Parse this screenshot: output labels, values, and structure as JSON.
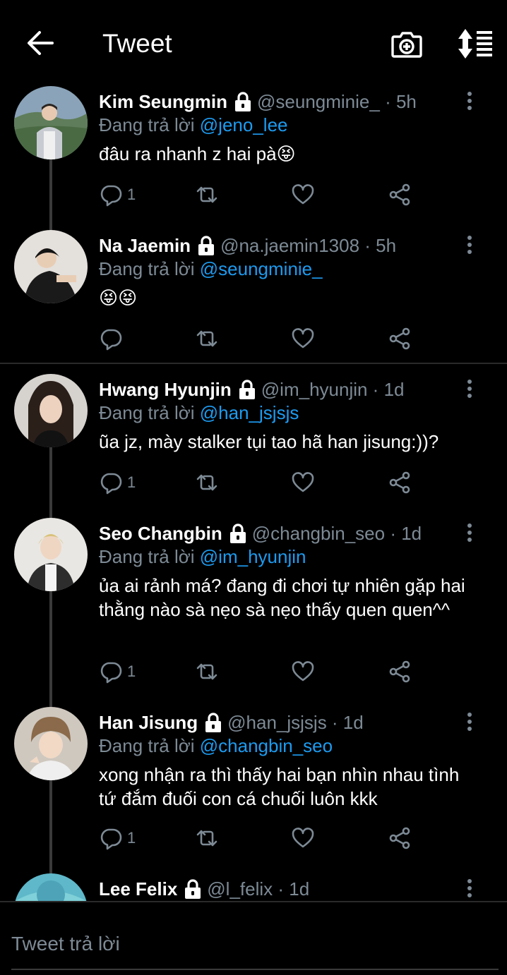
{
  "header": {
    "title": "Tweet"
  },
  "colors": {
    "accent": "#1d9bf0",
    "muted": "#7d8a95",
    "background": "#000000"
  },
  "tweets": [
    {
      "name": "Kim Seungmin",
      "handle": "@seungminie_ · 5h",
      "reply_prefix": "Đang trả lời ",
      "reply_to": "@jeno_lee",
      "text": "đâu ra nhanh z hai pà😝",
      "reply_count": "1"
    },
    {
      "name": "Na Jaemin",
      "handle": "@na.jaemin1308 · 5h",
      "reply_prefix": "Đang trả lời ",
      "reply_to": "@seungminie_",
      "text": "😝😝",
      "reply_count": ""
    },
    {
      "name": "Hwang Hyunjin",
      "handle": "@im_hyunjin · 1d",
      "reply_prefix": "Đang trả lời ",
      "reply_to": "@han_jsjsjs",
      "text": "ũa jz, mày stalker tụi tao hã han jisung:))?",
      "reply_count": "1"
    },
    {
      "name": "Seo Changbin",
      "handle": "@changbin_seo · 1d",
      "reply_prefix": "Đang trả lời ",
      "reply_to": "@im_hyunjin",
      "text": "ủa ai rảnh má? đang đi chơi tự nhiên gặp hai thằng nào sà nẹo sà nẹo thấy quen quen^^",
      "reply_count": "1"
    },
    {
      "name": "Han Jisung",
      "handle": "@han_jsjsjs · 1d",
      "reply_prefix": "Đang trả lời ",
      "reply_to": "@changbin_seo",
      "text": "xong nhận ra thì thấy hai bạn nhìn nhau tình tứ đắm đuối con cá chuối luôn kkk",
      "reply_count": "1"
    },
    {
      "name": "Lee Felix",
      "handle": "@l_felix · 1d"
    }
  ],
  "composer": {
    "placeholder": "Tweet trả lời"
  }
}
